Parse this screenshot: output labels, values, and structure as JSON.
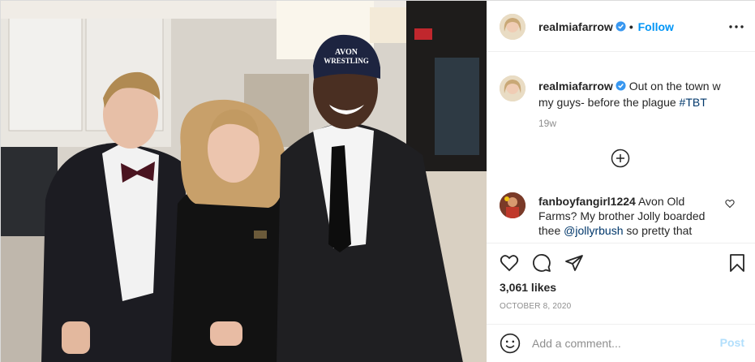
{
  "header": {
    "username": "realmiafarrow",
    "dot": "•",
    "follow_label": "Follow"
  },
  "caption": {
    "username": "realmiafarrow",
    "text": "Out on the town w my guys- before the plague",
    "hashtag": "#TBT",
    "age": "19w"
  },
  "comment": {
    "username": "fanboyfangirl1224",
    "text_before": "Avon Old Farms? My brother Jolly boarded thee",
    "mention": "@jollyrbush",
    "text_after": "so pretty that"
  },
  "photo": {
    "beanie_text_1": "AVON",
    "beanie_text_2": "WRESTLING"
  },
  "stats": {
    "likes": "3,061 likes",
    "date": "OCTOBER 8, 2020"
  },
  "add_comment": {
    "placeholder": "Add a comment...",
    "post_label": "Post"
  },
  "colors": {
    "accent": "#0095f6",
    "post_disabled": "#b2dffc",
    "link": "#00376b"
  },
  "icons": [
    "verified-icon",
    "more-icon",
    "add-comment-plus-icon",
    "heart-icon",
    "comment-icon",
    "share-icon",
    "bookmark-icon",
    "emoji-icon"
  ]
}
